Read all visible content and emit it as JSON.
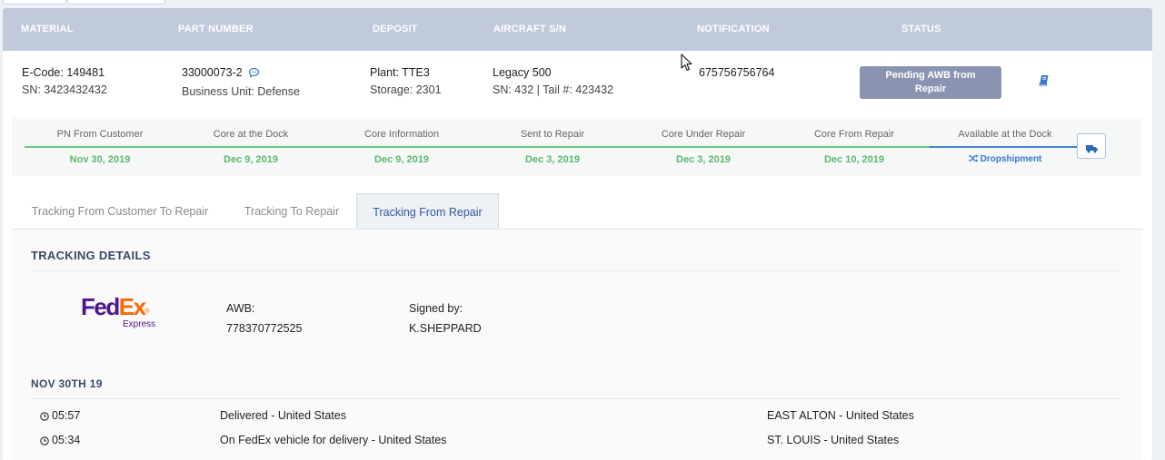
{
  "header": {
    "material": "MATERIAL",
    "part_number": "PART NUMBER",
    "deposit": "DEPOSIT",
    "aircraft_sn": "AIRCRAFT S/N",
    "notification": "NOTIFICATION",
    "status": "STATUS"
  },
  "row": {
    "ecode": "E-Code: 149481",
    "sn": "SN: 3423432432",
    "part_number": "33000073-2",
    "business_unit": "Business Unit: Defense",
    "plant": "Plant: TTE3",
    "storage": "Storage: 2301",
    "aircraft": "Legacy 500",
    "aircraft_sn_tail": "SN: 432 | Tail #: 423432",
    "notification": "675756756764",
    "status_line1": "Pending AWB from",
    "status_line2": "Repair",
    "icons": {
      "comment": "comment-icon",
      "book": "book-icon"
    }
  },
  "steps": [
    {
      "label": "PN From Customer",
      "date": "Nov 30, 2019"
    },
    {
      "label": "Core at the Dock",
      "date": "Dec 9, 2019"
    },
    {
      "label": "Core Information",
      "date": "Dec 9, 2019"
    },
    {
      "label": "Sent to Repair",
      "date": "Dec 3, 2019"
    },
    {
      "label": "Core Under Repair",
      "date": "Dec 3, 2019"
    },
    {
      "label": "Core From Repair",
      "date": "Dec 10, 2019"
    },
    {
      "label": "Available at the Dock",
      "date": "Dropshipment"
    }
  ],
  "tabs": [
    {
      "label": "Tracking From Customer To Repair"
    },
    {
      "label": "Tracking To Repair"
    },
    {
      "label": "Tracking From Repair"
    }
  ],
  "tracking": {
    "title": "TRACKING DETAILS",
    "carrier_logo": {
      "fed": "Fed",
      "ex": "Ex",
      "sub": "Express"
    },
    "awb_label": "AWB:",
    "awb_value": "778370772525",
    "signed_label": "Signed by:",
    "signed_value": "K.SHEPPARD",
    "date_heading": "NOV 30TH 19",
    "events": [
      {
        "time": "05:57",
        "description": "Delivered - United States",
        "location": "EAST ALTON - United States"
      },
      {
        "time": "05:34",
        "description": "On FedEx vehicle for delivery - United States",
        "location": "ST. LOUIS - United States"
      }
    ]
  },
  "colors": {
    "header_bg": "#c1cadb",
    "status_button": "#8a94b1",
    "step_green": "#5cb86e",
    "step_blue": "#3778d4",
    "active_tab_text": "#2f5a9e",
    "fedex_purple": "#4d148c",
    "fedex_orange": "#ff6600"
  }
}
